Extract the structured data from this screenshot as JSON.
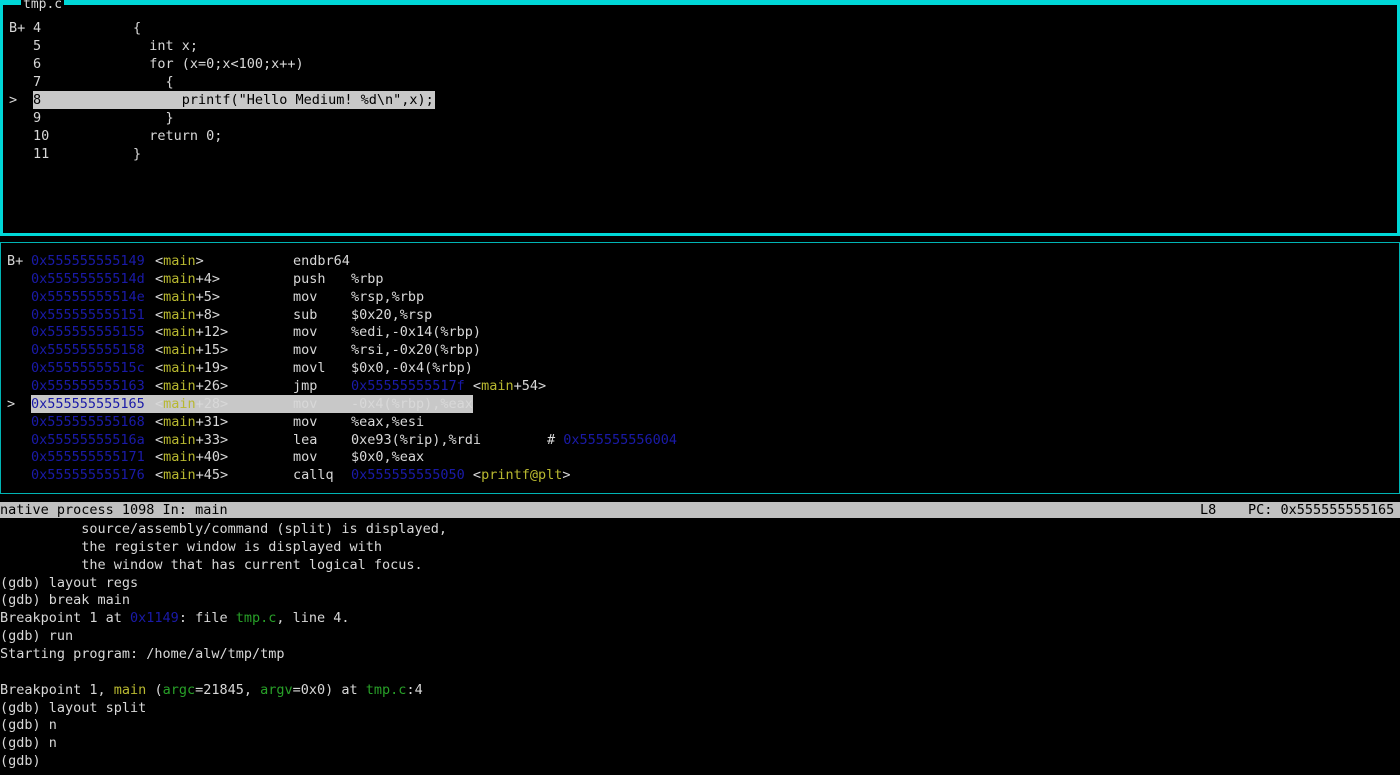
{
  "source_window": {
    "title": "tmp.c",
    "lines": [
      {
        "gutter": "B+",
        "num": "4",
        "code": "{"
      },
      {
        "gutter": "",
        "num": "5",
        "code": "  int x;"
      },
      {
        "gutter": "",
        "num": "6",
        "code": "  for (x=0;x<100;x++)"
      },
      {
        "gutter": "",
        "num": "7",
        "code": "    {"
      },
      {
        "gutter": ">",
        "num": "8",
        "code": "      printf(\"Hello Medium! %d\\n\",x);"
      },
      {
        "gutter": "",
        "num": "9",
        "code": "    }"
      },
      {
        "gutter": "",
        "num": "10",
        "code": "  return 0;"
      },
      {
        "gutter": "",
        "num": "11",
        "code": "}"
      }
    ],
    "current_line_index": 4
  },
  "asm_window": {
    "lines": [
      {
        "gutter": "B+",
        "addr": "0x555555555149",
        "fn": "main",
        "off": "",
        "mnem": "endbr64",
        "ops": "",
        "cmt": ""
      },
      {
        "gutter": "",
        "addr": "0x55555555514d",
        "fn": "main",
        "off": "+4",
        "mnem": "push",
        "ops": "%rbp",
        "cmt": ""
      },
      {
        "gutter": "",
        "addr": "0x55555555514e",
        "fn": "main",
        "off": "+5",
        "mnem": "mov",
        "ops": "%rsp,%rbp",
        "cmt": ""
      },
      {
        "gutter": "",
        "addr": "0x555555555151",
        "fn": "main",
        "off": "+8",
        "mnem": "sub",
        "ops": "$0x20,%rsp",
        "cmt": ""
      },
      {
        "gutter": "",
        "addr": "0x555555555155",
        "fn": "main",
        "off": "+12",
        "mnem": "mov",
        "ops": "%edi,-0x14(%rbp)",
        "cmt": ""
      },
      {
        "gutter": "",
        "addr": "0x555555555158",
        "fn": "main",
        "off": "+15",
        "mnem": "mov",
        "ops": "%rsi,-0x20(%rbp)",
        "cmt": ""
      },
      {
        "gutter": "",
        "addr": "0x55555555515c",
        "fn": "main",
        "off": "+19",
        "mnem": "movl",
        "ops": "$0x0,-0x4(%rbp)",
        "cmt": ""
      },
      {
        "gutter": "",
        "addr": "0x555555555163",
        "fn": "main",
        "off": "+26",
        "mnem": "jmp",
        "ops": "",
        "jmp_addr": "0x55555555517f",
        "jmp_sym": "main",
        "jmp_off": "+54",
        "cmt": ""
      },
      {
        "gutter": ">",
        "addr": "0x555555555165",
        "fn": "main",
        "off": "+28",
        "mnem": "mov",
        "ops": "-0x4(%rbp),%eax",
        "cmt": ""
      },
      {
        "gutter": "",
        "addr": "0x555555555168",
        "fn": "main",
        "off": "+31",
        "mnem": "mov",
        "ops": "%eax,%esi",
        "cmt": ""
      },
      {
        "gutter": "",
        "addr": "0x55555555516a",
        "fn": "main",
        "off": "+33",
        "mnem": "lea",
        "ops": "0xe93(%rip),%rdi",
        "cmt_prefix": "# ",
        "cmt_addr": "0x555555556004"
      },
      {
        "gutter": "",
        "addr": "0x555555555171",
        "fn": "main",
        "off": "+40",
        "mnem": "mov",
        "ops": "$0x0,%eax",
        "cmt": ""
      },
      {
        "gutter": "",
        "addr": "0x555555555176",
        "fn": "main",
        "off": "+45",
        "mnem": "callq",
        "ops": "",
        "call_addr": "0x555555555050",
        "call_sym": "printf@plt",
        "cmt": ""
      }
    ],
    "current_line_index": 8
  },
  "status_bar": {
    "left": "native process 1098 In: main",
    "line": "L8",
    "pc": "PC: 0x555555555165"
  },
  "command_window": {
    "lines": [
      {
        "segments": [
          {
            "t": "          source/assembly/command (split) is displayed,",
            "c": ""
          }
        ]
      },
      {
        "segments": [
          {
            "t": "          the register window is displayed with",
            "c": ""
          }
        ]
      },
      {
        "segments": [
          {
            "t": "          the window that has current logical focus.",
            "c": ""
          }
        ]
      },
      {
        "segments": [
          {
            "t": "(gdb) layout regs",
            "c": ""
          }
        ]
      },
      {
        "segments": [
          {
            "t": "(gdb) break main",
            "c": ""
          }
        ]
      },
      {
        "segments": [
          {
            "t": "Breakpoint 1 at ",
            "c": ""
          },
          {
            "t": "0x1149",
            "c": "a"
          },
          {
            "t": ": file ",
            "c": ""
          },
          {
            "t": "tmp.c",
            "c": "g"
          },
          {
            "t": ", line 4.",
            "c": ""
          }
        ]
      },
      {
        "segments": [
          {
            "t": "(gdb) run",
            "c": ""
          }
        ]
      },
      {
        "segments": [
          {
            "t": "Starting program: /home/alw/tmp/tmp",
            "c": ""
          }
        ]
      },
      {
        "segments": [
          {
            "t": "",
            "c": ""
          }
        ]
      },
      {
        "segments": [
          {
            "t": "Breakpoint 1, ",
            "c": ""
          },
          {
            "t": "main",
            "c": "y"
          },
          {
            "t": " (",
            "c": ""
          },
          {
            "t": "argc",
            "c": "g"
          },
          {
            "t": "=21845, ",
            "c": ""
          },
          {
            "t": "argv",
            "c": "g"
          },
          {
            "t": "=0x0) at ",
            "c": ""
          },
          {
            "t": "tmp.c",
            "c": "g"
          },
          {
            "t": ":4",
            "c": ""
          }
        ]
      },
      {
        "segments": [
          {
            "t": "(gdb) layout split",
            "c": ""
          }
        ]
      },
      {
        "segments": [
          {
            "t": "(gdb) n",
            "c": ""
          }
        ]
      },
      {
        "segments": [
          {
            "t": "(gdb) n",
            "c": ""
          }
        ]
      },
      {
        "segments": [
          {
            "t": "(gdb) ",
            "c": ""
          }
        ]
      }
    ]
  },
  "colors": {
    "frame": "#00d7d7",
    "address": "#1a1aa8",
    "function": "#b8b830",
    "file": "#28a028",
    "highlight_bg": "#c8c8c8"
  }
}
